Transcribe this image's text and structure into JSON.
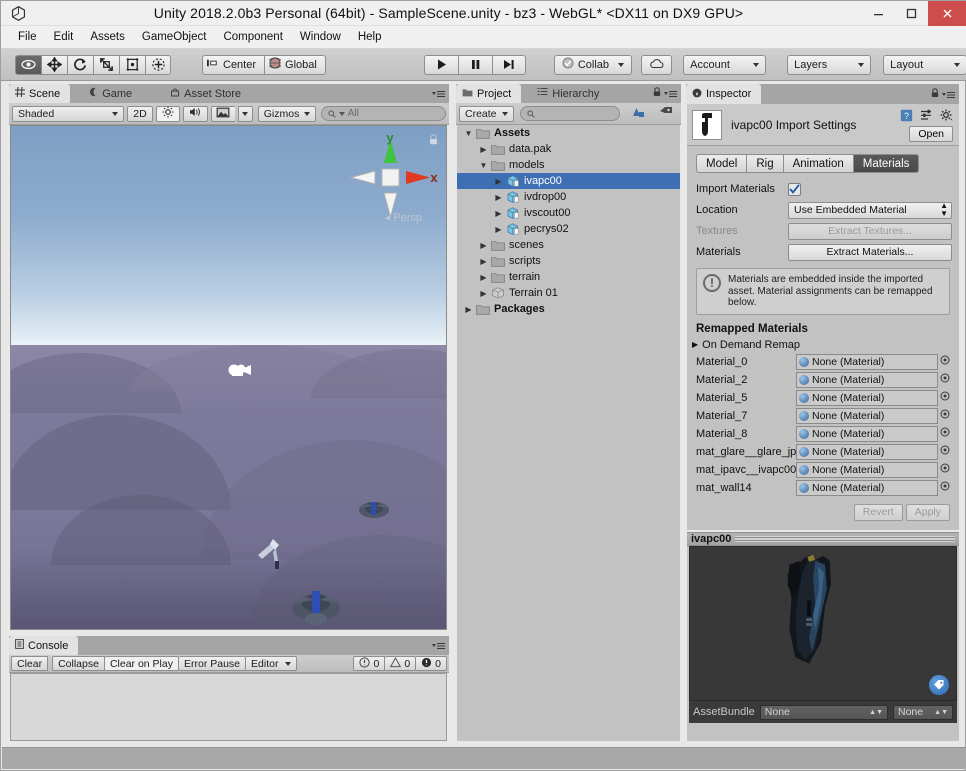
{
  "window": {
    "title": "Unity 2018.2.0b3 Personal (64bit) - SampleScene.unity - bz3 - WebGL* <DX11 on DX9 GPU>",
    "logo_icon": "unity-logo-icon",
    "minimize_label": "–",
    "maximize_label": "❐",
    "close_label": "×",
    "close_color": "#cd4c4c"
  },
  "menubar": {
    "items": [
      "File",
      "Edit",
      "Assets",
      "GameObject",
      "Component",
      "Window",
      "Help"
    ]
  },
  "toolbar": {
    "tools": [
      {
        "name": "hand-tool",
        "icon": "eye-hand-icon",
        "active": true
      },
      {
        "name": "move-tool",
        "icon": "move-arrows-icon",
        "active": false
      },
      {
        "name": "rotate-tool",
        "icon": "rotate-icon",
        "active": false
      },
      {
        "name": "scale-tool",
        "icon": "scale-icon",
        "active": false
      },
      {
        "name": "rect-tool",
        "icon": "rect-transform-icon",
        "active": false
      },
      {
        "name": "transform-tool",
        "icon": "combined-transform-icon",
        "active": false
      }
    ],
    "pivot_label": "Center",
    "pivot_icon": "pivot-center-icon",
    "space_label": "Global",
    "space_icon": "globe-icon",
    "play_label": "▶",
    "pause_label": "⏸",
    "step_label": "⏭",
    "collab_label": "Collab",
    "collab_icon": "collab-check-icon",
    "cloud_icon": "cloud-icon",
    "account_label": "Account",
    "layers_label": "Layers",
    "layout_label": "Layout"
  },
  "scene_panel": {
    "tabs": [
      {
        "label": "Scene",
        "icon": "scene-grid-icon",
        "active": true
      },
      {
        "label": "Game",
        "icon": "game-moon-icon",
        "active": false
      },
      {
        "label": "Asset Store",
        "icon": "store-icon",
        "active": false
      }
    ],
    "shading_mode": "Shaded",
    "mode_2d": "2D",
    "lighting_icon": "sun-icon",
    "audio_icon": "speaker-icon",
    "effects_icon": "image-icon",
    "gizmos_label": "Gizmos",
    "search_placeholder": "All",
    "search_icon": "search-icon",
    "perspective_label": "Persp",
    "gizmo_axes": {
      "y": "y",
      "x": "x"
    },
    "lock_icon": "lock-icon",
    "menu_icon": "panel-menu-icon"
  },
  "console_panel": {
    "tab_label": "Console",
    "tab_icon": "console-icon",
    "buttons": [
      "Clear",
      "Collapse",
      "Clear on Play",
      "Error Pause"
    ],
    "editor_label": "Editor",
    "counts": [
      {
        "icon": "info-icon",
        "value": "0"
      },
      {
        "icon": "warning-icon",
        "value": "0"
      },
      {
        "icon": "error-icon",
        "value": "0"
      }
    ],
    "menu_icon": "panel-menu-icon"
  },
  "project_panel": {
    "tabs": [
      {
        "label": "Project",
        "icon": "project-folder-icon",
        "active": true
      },
      {
        "label": "Hierarchy",
        "icon": "hierarchy-icon",
        "active": false
      }
    ],
    "create_label": "Create",
    "search_placeholder": "",
    "search_icon": "search-icon",
    "filter_type_icon": "filter-by-type-icon",
    "filter_label_icon": "filter-by-label-icon",
    "lock_icon": "lock-icon",
    "menu_icon": "panel-menu-icon",
    "tree": [
      {
        "label": "Assets",
        "indent": 0,
        "arrow": "down",
        "icon": "folder-icon",
        "bold": true,
        "selected": false
      },
      {
        "label": "data.pak",
        "indent": 1,
        "arrow": "right",
        "icon": "folder-icon",
        "bold": false,
        "selected": false
      },
      {
        "label": "models",
        "indent": 1,
        "arrow": "down",
        "icon": "folder-icon",
        "bold": false,
        "selected": false
      },
      {
        "label": "ivapc00",
        "indent": 2,
        "arrow": "right",
        "icon": "prefab-icon",
        "bold": false,
        "selected": true
      },
      {
        "label": "ivdrop00",
        "indent": 2,
        "arrow": "right",
        "icon": "prefab-icon",
        "bold": false,
        "selected": false
      },
      {
        "label": "ivscout00",
        "indent": 2,
        "arrow": "right",
        "icon": "prefab-icon",
        "bold": false,
        "selected": false
      },
      {
        "label": "pecrys02",
        "indent": 2,
        "arrow": "right",
        "icon": "prefab-icon",
        "bold": false,
        "selected": false
      },
      {
        "label": "scenes",
        "indent": 1,
        "arrow": "right",
        "icon": "folder-icon",
        "bold": false,
        "selected": false
      },
      {
        "label": "scripts",
        "indent": 1,
        "arrow": "right",
        "icon": "folder-icon",
        "bold": false,
        "selected": false
      },
      {
        "label": "terrain",
        "indent": 1,
        "arrow": "right",
        "icon": "folder-icon",
        "bold": false,
        "selected": false
      },
      {
        "label": "Terrain 01",
        "indent": 1,
        "arrow": "right",
        "icon": "terrain-asset-icon",
        "bold": false,
        "selected": false
      },
      {
        "label": "Packages",
        "indent": 0,
        "arrow": "right",
        "icon": "folder-icon",
        "bold": true,
        "selected": false
      }
    ]
  },
  "inspector": {
    "tab_label": "Inspector",
    "tab_icon": "info-circle-icon",
    "lock_icon": "lock-icon",
    "menu_icon": "panel-menu-icon",
    "asset_icon": "model-thumbnail-icon",
    "title": "ivapc00 Import Settings",
    "header_icons": [
      "help-book-icon",
      "preset-icon",
      "gear-icon"
    ],
    "open_label": "Open",
    "tabs": [
      {
        "label": "Model",
        "active": false
      },
      {
        "label": "Rig",
        "active": false
      },
      {
        "label": "Animation",
        "active": false
      },
      {
        "label": "Materials",
        "active": true
      }
    ],
    "import_materials_label": "Import Materials",
    "import_materials_checked": true,
    "location_label": "Location",
    "location_value": "Use Embedded Material",
    "textures_label": "Textures",
    "textures_button": "Extract Textures...",
    "materials_label": "Materials",
    "materials_button": "Extract Materials...",
    "help_icon": "info-exclaim-icon",
    "help_text": "Materials are embedded inside the imported asset. Material assignments can be remapped below.",
    "remapped_header": "Remapped Materials",
    "on_demand_label": "On Demand Remap",
    "material_rows": [
      {
        "name": "Material_0",
        "value": "None (Material)"
      },
      {
        "name": "Material_2",
        "value": "None (Material)"
      },
      {
        "name": "Material_5",
        "value": "None (Material)"
      },
      {
        "name": "Material_7",
        "value": "None (Material)"
      },
      {
        "name": "Material_8",
        "value": "None (Material)"
      },
      {
        "name": "mat_glare__glare_jp",
        "value": "None (Material)"
      },
      {
        "name": "mat_ipavc__ivapc00",
        "value": "None (Material)"
      },
      {
        "name": "mat_wall14",
        "value": "None (Material)"
      }
    ],
    "revert_label": "Revert",
    "apply_label": "Apply"
  },
  "preview": {
    "title": "ivapc00",
    "tag_icon": "label-tag-icon",
    "assetbundle_label": "AssetBundle",
    "bundle_value": "None",
    "variant_value": "None"
  }
}
